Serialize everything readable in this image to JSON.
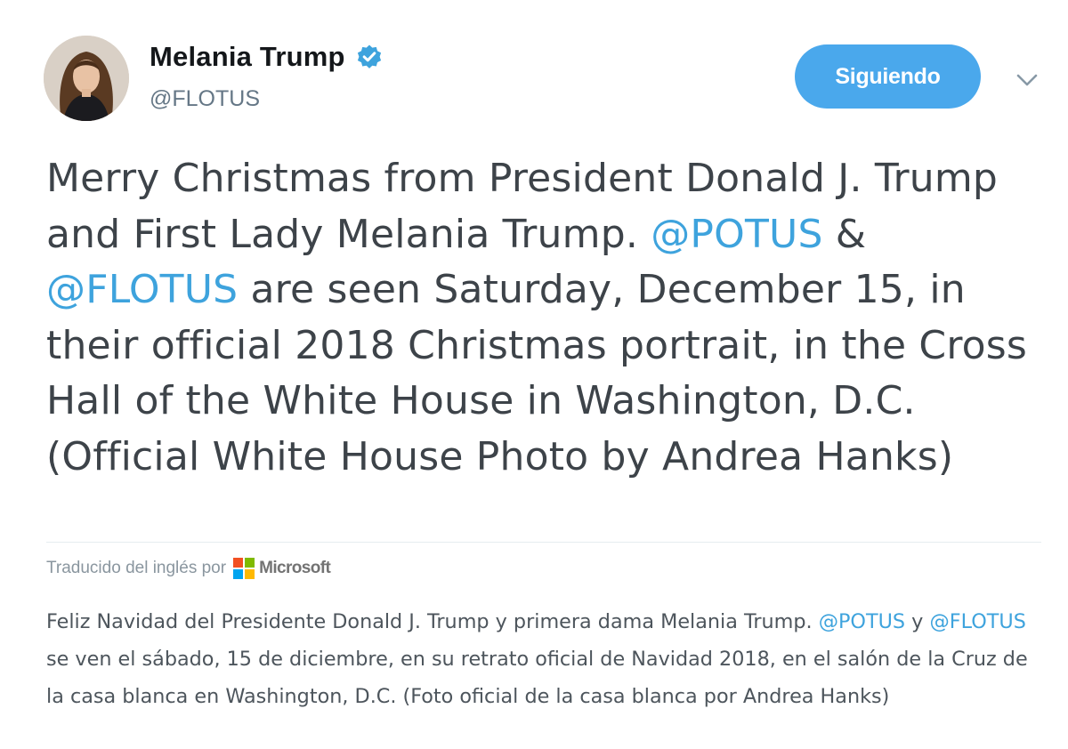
{
  "tweet": {
    "author": {
      "display_name": "Melania Trump",
      "handle": "@FLOTUS",
      "verified": true,
      "verified_icon": "verified-badge-icon"
    },
    "follow_button_label": "Siguiendo",
    "menu_icon": "chevron-down-icon",
    "text": {
      "part1": "Merry Christmas from President Donald J. Trump and First Lady Melania Trump. ",
      "mention1": "@POTUS",
      "part2": " & ",
      "mention2": "@FLOTUS",
      "part3": " are seen Saturday, December 15, in their official 2018 Christmas portrait, in the Cross Hall of the White House in Washington, D.C. (Official White House Photo by Andrea Hanks)"
    },
    "translation": {
      "label": "Traducido del inglés por",
      "provider": "Microsoft",
      "provider_icon": "microsoft-logo-icon",
      "part1": "Feliz Navidad del Presidente Donald J. Trump y primera dama Melania Trump. ",
      "mention1": "@POTUS",
      "part2": " y ",
      "mention2": "@FLOTUS",
      "part3": " se ven el sábado, 15 de diciembre, en su retrato oficial de Navidad 2018, en el salón de la Cruz de la casa blanca en Washington, D.C. (Foto oficial de la casa blanca por Andrea Hanks)"
    }
  },
  "colors": {
    "accent": "#4aa8ec",
    "link": "#3ea3dd",
    "text": "#3d4349",
    "muted": "#657786",
    "divider": "#e6ecf0"
  }
}
